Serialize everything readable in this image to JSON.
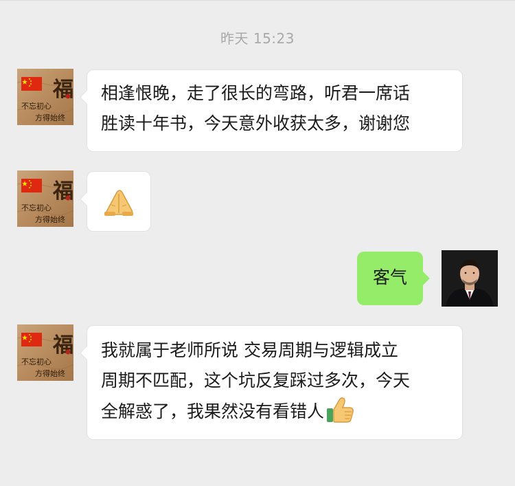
{
  "chat": {
    "timestamp": "昨天 15:23",
    "messages": [
      {
        "side": "left",
        "sender_avatar": "fu-flag-avatar-icon",
        "lines": [
          "相逢恨晚，走了很长的弯路，听君一席话",
          "胜读十年书，今天意外收获太多，谢谢您"
        ]
      },
      {
        "side": "left",
        "sender_avatar": "fu-flag-avatar-icon",
        "emoji": "folded-hands-icon"
      },
      {
        "side": "right",
        "sender_avatar": "man-in-suit-avatar-icon",
        "lines": [
          "客气"
        ]
      },
      {
        "side": "left",
        "sender_avatar": "fu-flag-avatar-icon",
        "lines": [
          "我就属于老师所说 交易周期与逻辑成立",
          "周期不匹配，这个坑反复踩过多次，今天",
          "全解惑了，我果然没有看错人"
        ],
        "trailing_emoji": "thumbs-up-icon"
      }
    ]
  },
  "avatar_text": {
    "fu": "福",
    "motto_line_1": "不忘初心",
    "motto_line_2": "方得始终"
  },
  "colors": {
    "background": "#ededed",
    "incoming_bubble": "#ffffff",
    "outgoing_bubble": "#95ec69",
    "timestamp": "#a9a9a9",
    "text": "#1b1b1b"
  }
}
